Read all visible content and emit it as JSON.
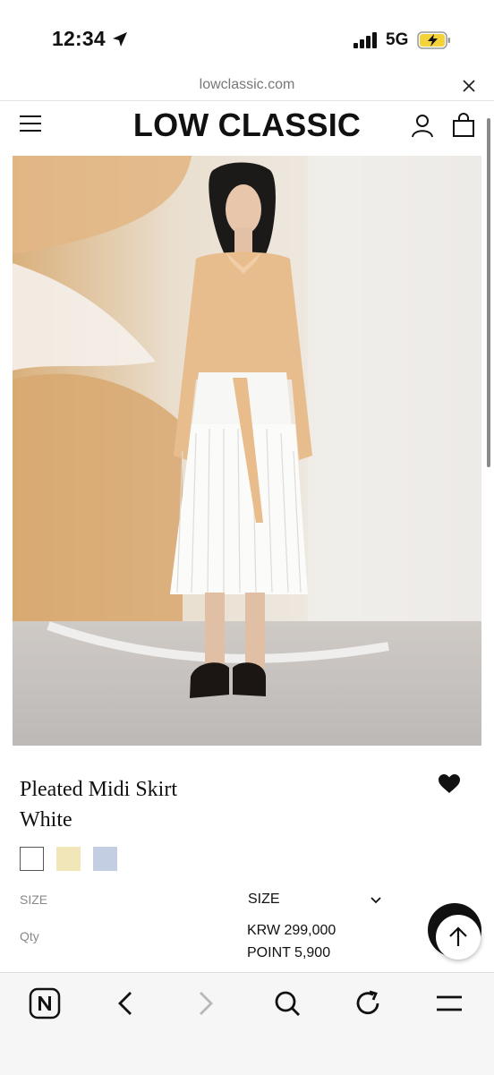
{
  "status": {
    "time": "12:34",
    "network": "5G"
  },
  "browser": {
    "url": "lowclassic.com"
  },
  "header": {
    "logo": "LOW CLASSIC"
  },
  "product": {
    "name": "Pleated Midi Skirt",
    "color": "White",
    "swatches": [
      {
        "name": "white",
        "color": "#ffffff"
      },
      {
        "name": "butter",
        "color": "#f1e6b8"
      },
      {
        "name": "light-blue",
        "color": "#c3cee3"
      }
    ],
    "size_label": "SIZE",
    "size_select": "SIZE",
    "qty_label": "Qty",
    "price": "KRW 299,000",
    "points": "POINT 5,900"
  },
  "toolbar": {
    "items": [
      "naver-home-icon",
      "back-icon",
      "forward-icon",
      "search-icon",
      "reload-icon",
      "menu-icon"
    ]
  }
}
